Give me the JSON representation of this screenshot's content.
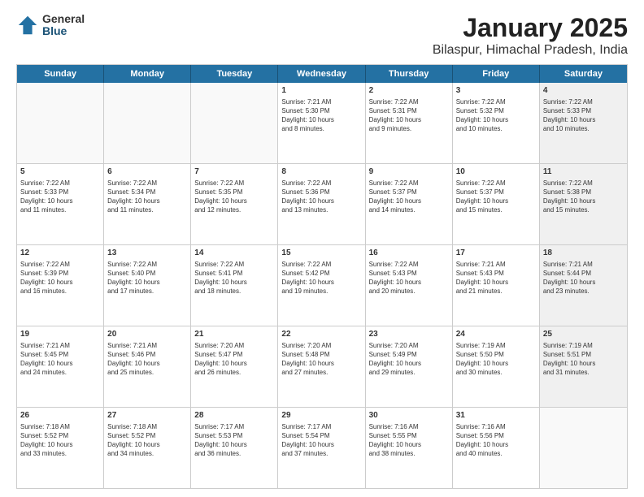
{
  "header": {
    "logo_general": "General",
    "logo_blue": "Blue",
    "title": "January 2025",
    "subtitle": "Bilaspur, Himachal Pradesh, India"
  },
  "calendar": {
    "days": [
      "Sunday",
      "Monday",
      "Tuesday",
      "Wednesday",
      "Thursday",
      "Friday",
      "Saturday"
    ],
    "rows": [
      [
        {
          "day": "",
          "content": "",
          "empty": true
        },
        {
          "day": "",
          "content": "",
          "empty": true
        },
        {
          "day": "",
          "content": "",
          "empty": true
        },
        {
          "day": "1",
          "content": "Sunrise: 7:21 AM\nSunset: 5:30 PM\nDaylight: 10 hours\nand 8 minutes.",
          "empty": false,
          "shaded": false
        },
        {
          "day": "2",
          "content": "Sunrise: 7:22 AM\nSunset: 5:31 PM\nDaylight: 10 hours\nand 9 minutes.",
          "empty": false,
          "shaded": false
        },
        {
          "day": "3",
          "content": "Sunrise: 7:22 AM\nSunset: 5:32 PM\nDaylight: 10 hours\nand 10 minutes.",
          "empty": false,
          "shaded": false
        },
        {
          "day": "4",
          "content": "Sunrise: 7:22 AM\nSunset: 5:33 PM\nDaylight: 10 hours\nand 10 minutes.",
          "empty": false,
          "shaded": true
        }
      ],
      [
        {
          "day": "5",
          "content": "Sunrise: 7:22 AM\nSunset: 5:33 PM\nDaylight: 10 hours\nand 11 minutes.",
          "empty": false,
          "shaded": false
        },
        {
          "day": "6",
          "content": "Sunrise: 7:22 AM\nSunset: 5:34 PM\nDaylight: 10 hours\nand 11 minutes.",
          "empty": false,
          "shaded": false
        },
        {
          "day": "7",
          "content": "Sunrise: 7:22 AM\nSunset: 5:35 PM\nDaylight: 10 hours\nand 12 minutes.",
          "empty": false,
          "shaded": false
        },
        {
          "day": "8",
          "content": "Sunrise: 7:22 AM\nSunset: 5:36 PM\nDaylight: 10 hours\nand 13 minutes.",
          "empty": false,
          "shaded": false
        },
        {
          "day": "9",
          "content": "Sunrise: 7:22 AM\nSunset: 5:37 PM\nDaylight: 10 hours\nand 14 minutes.",
          "empty": false,
          "shaded": false
        },
        {
          "day": "10",
          "content": "Sunrise: 7:22 AM\nSunset: 5:37 PM\nDaylight: 10 hours\nand 15 minutes.",
          "empty": false,
          "shaded": false
        },
        {
          "day": "11",
          "content": "Sunrise: 7:22 AM\nSunset: 5:38 PM\nDaylight: 10 hours\nand 15 minutes.",
          "empty": false,
          "shaded": true
        }
      ],
      [
        {
          "day": "12",
          "content": "Sunrise: 7:22 AM\nSunset: 5:39 PM\nDaylight: 10 hours\nand 16 minutes.",
          "empty": false,
          "shaded": false
        },
        {
          "day": "13",
          "content": "Sunrise: 7:22 AM\nSunset: 5:40 PM\nDaylight: 10 hours\nand 17 minutes.",
          "empty": false,
          "shaded": false
        },
        {
          "day": "14",
          "content": "Sunrise: 7:22 AM\nSunset: 5:41 PM\nDaylight: 10 hours\nand 18 minutes.",
          "empty": false,
          "shaded": false
        },
        {
          "day": "15",
          "content": "Sunrise: 7:22 AM\nSunset: 5:42 PM\nDaylight: 10 hours\nand 19 minutes.",
          "empty": false,
          "shaded": false
        },
        {
          "day": "16",
          "content": "Sunrise: 7:22 AM\nSunset: 5:43 PM\nDaylight: 10 hours\nand 20 minutes.",
          "empty": false,
          "shaded": false
        },
        {
          "day": "17",
          "content": "Sunrise: 7:21 AM\nSunset: 5:43 PM\nDaylight: 10 hours\nand 21 minutes.",
          "empty": false,
          "shaded": false
        },
        {
          "day": "18",
          "content": "Sunrise: 7:21 AM\nSunset: 5:44 PM\nDaylight: 10 hours\nand 23 minutes.",
          "empty": false,
          "shaded": true
        }
      ],
      [
        {
          "day": "19",
          "content": "Sunrise: 7:21 AM\nSunset: 5:45 PM\nDaylight: 10 hours\nand 24 minutes.",
          "empty": false,
          "shaded": false
        },
        {
          "day": "20",
          "content": "Sunrise: 7:21 AM\nSunset: 5:46 PM\nDaylight: 10 hours\nand 25 minutes.",
          "empty": false,
          "shaded": false
        },
        {
          "day": "21",
          "content": "Sunrise: 7:20 AM\nSunset: 5:47 PM\nDaylight: 10 hours\nand 26 minutes.",
          "empty": false,
          "shaded": false
        },
        {
          "day": "22",
          "content": "Sunrise: 7:20 AM\nSunset: 5:48 PM\nDaylight: 10 hours\nand 27 minutes.",
          "empty": false,
          "shaded": false
        },
        {
          "day": "23",
          "content": "Sunrise: 7:20 AM\nSunset: 5:49 PM\nDaylight: 10 hours\nand 29 minutes.",
          "empty": false,
          "shaded": false
        },
        {
          "day": "24",
          "content": "Sunrise: 7:19 AM\nSunset: 5:50 PM\nDaylight: 10 hours\nand 30 minutes.",
          "empty": false,
          "shaded": false
        },
        {
          "day": "25",
          "content": "Sunrise: 7:19 AM\nSunset: 5:51 PM\nDaylight: 10 hours\nand 31 minutes.",
          "empty": false,
          "shaded": true
        }
      ],
      [
        {
          "day": "26",
          "content": "Sunrise: 7:18 AM\nSunset: 5:52 PM\nDaylight: 10 hours\nand 33 minutes.",
          "empty": false,
          "shaded": false
        },
        {
          "day": "27",
          "content": "Sunrise: 7:18 AM\nSunset: 5:52 PM\nDaylight: 10 hours\nand 34 minutes.",
          "empty": false,
          "shaded": false
        },
        {
          "day": "28",
          "content": "Sunrise: 7:17 AM\nSunset: 5:53 PM\nDaylight: 10 hours\nand 36 minutes.",
          "empty": false,
          "shaded": false
        },
        {
          "day": "29",
          "content": "Sunrise: 7:17 AM\nSunset: 5:54 PM\nDaylight: 10 hours\nand 37 minutes.",
          "empty": false,
          "shaded": false
        },
        {
          "day": "30",
          "content": "Sunrise: 7:16 AM\nSunset: 5:55 PM\nDaylight: 10 hours\nand 38 minutes.",
          "empty": false,
          "shaded": false
        },
        {
          "day": "31",
          "content": "Sunrise: 7:16 AM\nSunset: 5:56 PM\nDaylight: 10 hours\nand 40 minutes.",
          "empty": false,
          "shaded": false
        },
        {
          "day": "",
          "content": "",
          "empty": true,
          "shaded": true
        }
      ]
    ]
  }
}
